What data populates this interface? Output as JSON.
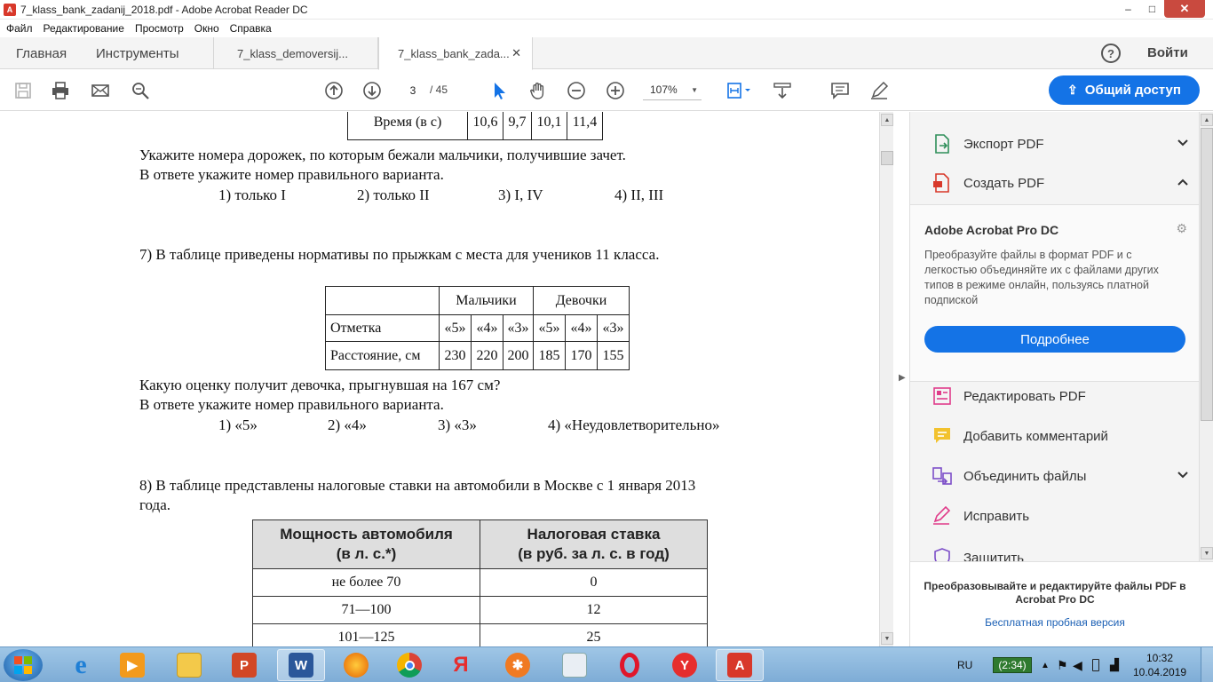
{
  "window": {
    "title": "7_klass_bank_zadanij_2018.pdf - Adobe Acrobat Reader DC",
    "minimize": "–",
    "maximize": "□",
    "close": "✕"
  },
  "menu": [
    "Файл",
    "Редактирование",
    "Просмотр",
    "Окно",
    "Справка"
  ],
  "tabs": {
    "home": "Главная",
    "tools": "Инструменты",
    "doc1": "7_klass_demoversij...",
    "doc2": "7_klass_bank_zada...",
    "close_glyph": "✕"
  },
  "header": {
    "help": "?",
    "signin": "Войти"
  },
  "toolbar": {
    "page_current": "3",
    "page_total": "/ 45",
    "zoom": "107%",
    "share_label": "Общий доступ",
    "icons": [
      "save-icon",
      "print-icon",
      "mail-icon",
      "search-icon",
      "page-up-icon",
      "page-down-icon",
      "select-cursor-icon",
      "hand-icon",
      "zoom-out-icon",
      "zoom-in-icon",
      "fit-page-icon",
      "scroll-mode-icon",
      "comment-icon",
      "pen-icon"
    ]
  },
  "document": {
    "table1": {
      "label": "Время (в с)",
      "values": [
        "10,6",
        "9,7",
        "10,1",
        "11,4"
      ]
    },
    "q6_line1": "Укажите номера дорожек, по которым бежали мальчики, получившие зачет.",
    "q6_line2": "В ответе укажите номер правильного варианта.",
    "q6_options": [
      "1) только I",
      "2) только II",
      "3) I, IV",
      "4) II, III"
    ],
    "q7_text": "7) В таблице приведены нормативы по прыжкам с места для учеников 11 класса.",
    "table2": {
      "header": [
        "",
        "Мальчики",
        "Девочки"
      ],
      "row1_label": "Отметка",
      "row1": [
        "«5»",
        "«4»",
        "«3»",
        "«5»",
        "«4»",
        "«3»"
      ],
      "row2_label": "Расстояние, см",
      "row2": [
        "230",
        "220",
        "200",
        "185",
        "170",
        "155"
      ]
    },
    "q7_line1": "Какую оценку получит девочка, прыгнувшая на 167 см?",
    "q7_line2": "В ответе укажите номер правильного варианта.",
    "q7_options": [
      "1) «5»",
      "2) «4»",
      "3) «3»",
      "4) «Неудовлетворительно»"
    ],
    "q8_line1": "8) В таблице представлены налоговые ставки на автомобили в Москве с 1 января 2013",
    "q8_line2": "года.",
    "table3": {
      "head1_line1": "Мощность автомобиля",
      "head1_line2": "(в л. с.*)",
      "head2_line1": "Налоговая ставка",
      "head2_line2": "(в руб. за л. с. в год)",
      "rows": [
        [
          "не более 70",
          "0"
        ],
        [
          "71—100",
          "12"
        ],
        [
          "101—125",
          "25"
        ]
      ]
    }
  },
  "right_pane": {
    "export_pdf": "Экспорт PDF",
    "create_pdf": "Создать PDF",
    "promo_title": "Adobe Acrobat Pro DC",
    "promo_desc": "Преобразуйте файлы в формат PDF и с легкостью объединяйте их с файлами других типов в режиме онлайн, пользуясь платной подпиской",
    "promo_button": "Подробнее",
    "edit_pdf": "Редактировать PDF",
    "add_comment": "Добавить комментарий",
    "combine_files": "Объединить файлы",
    "fill_sign": "Исправить",
    "protect": "Защитить",
    "bottom_text": "Преобразовывайте и редактируйте файлы PDF в Acrobat Pro DC",
    "bottom_link": "Бесплатная пробная версия"
  },
  "taskbar": {
    "apps": [
      "internet-explorer",
      "media-player",
      "file-explorer",
      "powerpoint",
      "word",
      "firefox",
      "chrome",
      "yandex",
      "media-player-classic",
      "store-app",
      "opera",
      "yandex-browser",
      "acrobat-reader"
    ],
    "lang": "RU",
    "battery": "(2:34)",
    "time": "10:32",
    "date": "10.04.2019"
  },
  "colors": {
    "accent": "#1473e6",
    "close": "#c94a3f",
    "taskbar": "#8fb8e0"
  }
}
